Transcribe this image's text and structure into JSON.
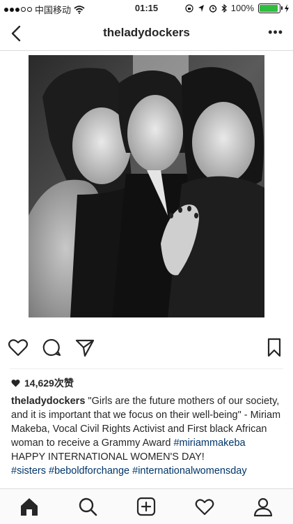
{
  "status_bar": {
    "carrier": "中国移动",
    "time": "01:15",
    "battery": "100%",
    "signal_icon": "signal-dots-icon",
    "wifi_icon": "wifi-icon"
  },
  "nav": {
    "title": "theladydockers",
    "more_label": "•••"
  },
  "post": {
    "likes": "14,629次赞",
    "caption_user": "theladydockers",
    "caption_text": " \"Girls are the future mothers of our society, and it is important that we focus on their well-being\" - Miriam Makeba, Vocal Civil Rights Activist and First black African woman to receive a Grammy Award ",
    "caption_tag1": "#miriammakeba",
    "caption_line2": "HAPPY INTERNATIONAL WOMEN'S DAY!",
    "tags": [
      "#sisters",
      "#beboldforchange",
      "#internationalwomensday"
    ]
  },
  "colors": {
    "battery_green": "#2dbe3d",
    "hashtag_blue": "#003569",
    "text": "#262626"
  }
}
